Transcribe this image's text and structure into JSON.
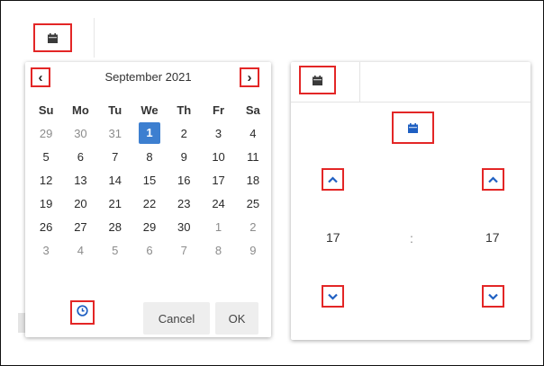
{
  "calendar": {
    "month_title": "September 2021",
    "prev_label": "‹",
    "next_label": "›",
    "weekdays": [
      "Su",
      "Mo",
      "Tu",
      "We",
      "Th",
      "Fr",
      "Sa"
    ],
    "weeks": [
      [
        "29",
        "30",
        "31",
        "1",
        "2",
        "3",
        "4"
      ],
      [
        "5",
        "6",
        "7",
        "8",
        "9",
        "10",
        "11"
      ],
      [
        "12",
        "13",
        "14",
        "15",
        "16",
        "17",
        "18"
      ],
      [
        "19",
        "20",
        "21",
        "22",
        "23",
        "24",
        "25"
      ],
      [
        "26",
        "27",
        "28",
        "29",
        "30",
        "1",
        "2"
      ],
      [
        "3",
        "4",
        "5",
        "6",
        "7",
        "8",
        "9"
      ]
    ],
    "selected_day": "1",
    "cancel_label": "Cancel",
    "ok_label": "OK"
  },
  "time_picker": {
    "hours": "17",
    "separator": ":",
    "minutes": "17"
  },
  "icons": {
    "toolbar_calendar": "calendar-icon",
    "clock": "clock-icon",
    "up": "chevron-up-icon",
    "down": "chevron-down-icon"
  },
  "colors": {
    "highlight_border": "#e32626",
    "selected_day_bg": "#3d7fd0",
    "accent_blue": "#1e5fc2"
  }
}
